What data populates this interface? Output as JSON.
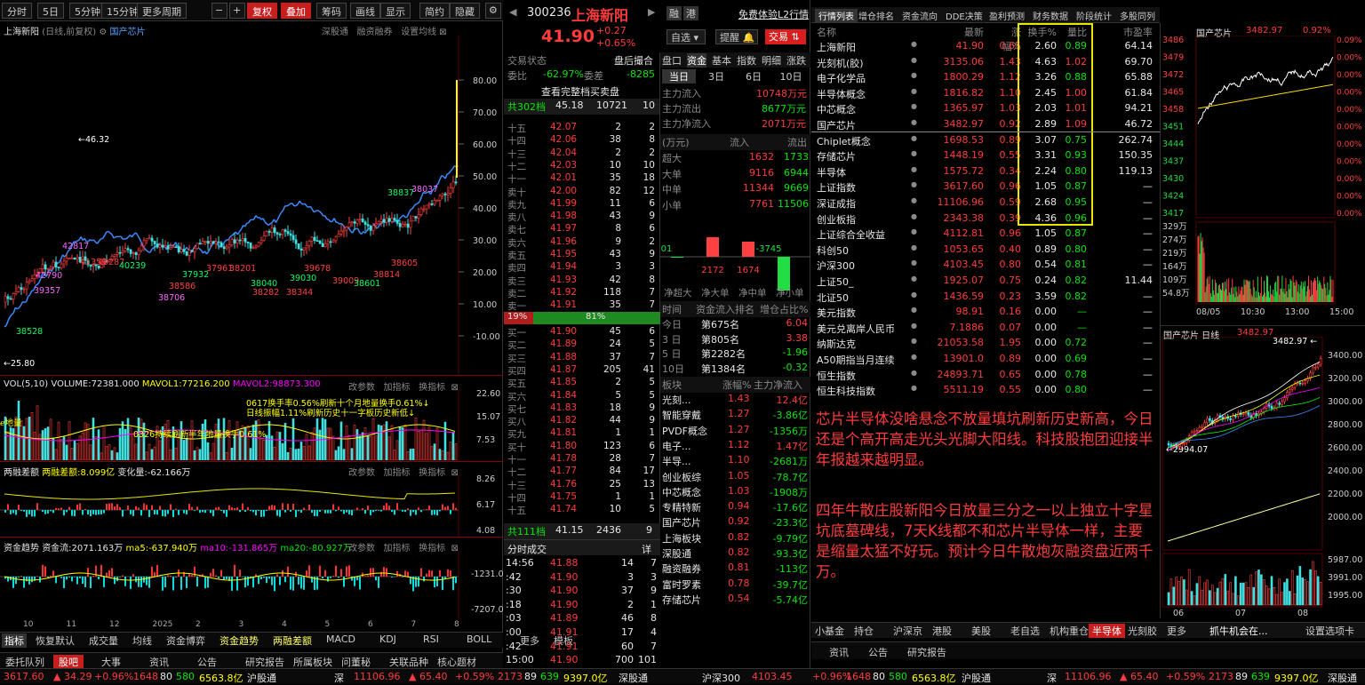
{
  "toolbar": {
    "items": [
      "分时",
      "5日",
      "5分钟",
      "15分钟",
      "更多周期",
      "复权",
      "叠加",
      "筹码",
      "画线",
      "显示",
      "简约",
      "隐藏"
    ],
    "stock_line": "上海新阳",
    "stock_opt": "(日线,前复权)",
    "concept": "国产芯片",
    "right_links": [
      "深股通",
      "融资融券",
      "设置均线"
    ]
  },
  "kchart": {
    "ylabels": [
      "80.00",
      "70.00",
      "60.00",
      "50.00",
      "40.00",
      "30.00",
      "20.00",
      "10.00",
      "-10.00"
    ],
    "hi_label": "46.32",
    "lo_label": "25.80",
    "markers": [
      "38528",
      "39357",
      "42790",
      "42817",
      "41359",
      "40287",
      "40239",
      "38586",
      "38706",
      "37932",
      "37961",
      "38201",
      "38040",
      "38282",
      "38344",
      "39030",
      "39678",
      "39009",
      "38601",
      "38814",
      "38605",
      "38837",
      "38037"
    ]
  },
  "vol": {
    "title": "VOL(5,10)",
    "v1": "VOLUME:72381.000",
    "v2": "MAVOL1:77216.200",
    "v3": "MAVOL2:98873.300",
    "note1": "0617换手率0.56%刷新十个月地量换手0.61%↓",
    "note2": "日线振幅1.11%刷新历史十一字板历史新低↓",
    "note3": "0326持续刷新半年地量换手0.61%",
    "note_left": "ℯ地量",
    "btns": [
      "改参数",
      "加指标",
      "换指标"
    ],
    "ylabels": [
      "22.60",
      "15.07",
      "7.53"
    ]
  },
  "rz": {
    "title": "两融差额",
    "v1": "两融差额:8.099亿",
    "v2": "变化量:-62.166万",
    "btns": [
      "改参数",
      "加指标",
      "换指标"
    ],
    "ylabels": [
      "8.26",
      "6.17",
      "4.08"
    ]
  },
  "fund": {
    "title": "资金趋势",
    "v1": "资金流:2071.163万",
    "v2": "ma5:-637.940万",
    "v3": "ma10:-131.865万",
    "v4": "ma20:-80.927万",
    "btns": [
      "改参数",
      "加指标",
      "换指标"
    ],
    "ylabels": [
      "-1231.00",
      "-7207.00"
    ]
  },
  "xaxis": [
    "10",
    "11",
    "12",
    "2025",
    "2",
    "3",
    "4",
    "5",
    "6",
    "7",
    "8"
  ],
  "indtabs": [
    "指标",
    "恢复默认",
    "成交量",
    "均线",
    "资金博弈",
    "资金趋势",
    "两融差额",
    "MACD",
    "KDJ",
    "RSI",
    "BOLL",
    "更多",
    "模板"
  ],
  "bottabs": [
    "委托队列",
    "股吧",
    "大事",
    "资讯",
    "公告",
    "研究报告",
    "所属板块",
    "问董秘",
    "关联品种",
    "核心题材"
  ],
  "status": {
    "sh": "3617.60",
    "sh_chg": "▲ 34.29",
    "sh_pct": "+0.96%",
    "sh_up": "1648",
    "sh_fl": "80",
    "sh_dn": "580",
    "sh_amt": "6563.8亿",
    "hgt": "沪股通",
    "sz": "深",
    "sz_val": "11106.96",
    "sz_chg": "▲ 65.40",
    "sz_pct": "+0.59%",
    "sz_up": "2173",
    "sz_fl": "89",
    "sz_dn": "639",
    "sz_amt": "9397.0亿",
    "sgt": "深股通",
    "hs300": "沪深300",
    "hs300_val": "4103.45"
  },
  "quote": {
    "code": "300236",
    "name": "上海新阳",
    "price": "41.90",
    "chg": "+0.27",
    "pct": "+0.65%",
    "btn1": "融",
    "btn2": "港",
    "promo": "免费体验L2行情",
    "btn_zx": "自选",
    "btn_tx": "提醒",
    "btn_jy": "交易",
    "state_label": "交易状态",
    "state_val": "盘后撮合",
    "wb_label": "委比",
    "wb_val": "-62.97%",
    "wc_label": "委差",
    "wc_val": "-8285",
    "full_link": "查看完整档买卖盘",
    "total_label": "共302档",
    "total_price": "45.18",
    "total_vol": "10721",
    "total_n": "10"
  },
  "asks": [
    [
      "十五",
      "42.07",
      "2",
      "2"
    ],
    [
      "十四",
      "42.06",
      "38",
      "8"
    ],
    [
      "十三",
      "42.04",
      "2",
      "2"
    ],
    [
      "十二",
      "42.03",
      "10",
      "10"
    ],
    [
      "十一",
      "42.01",
      "35",
      "18"
    ],
    [
      "卖十",
      "42.00",
      "82",
      "12"
    ],
    [
      "卖九",
      "41.99",
      "11",
      "6"
    ],
    [
      "卖八",
      "41.98",
      "43",
      "9"
    ],
    [
      "卖七",
      "41.97",
      "8",
      "6"
    ],
    [
      "卖六",
      "41.96",
      "9",
      "2"
    ],
    [
      "卖五",
      "41.95",
      "43",
      "9"
    ],
    [
      "卖四",
      "41.94",
      "3",
      "3"
    ],
    [
      "卖三",
      "41.93",
      "42",
      "8"
    ],
    [
      "卖二",
      "41.92",
      "118",
      "7"
    ],
    [
      "卖一",
      "41.91",
      "35",
      "7"
    ]
  ],
  "ratio": {
    "left": "19%",
    "right": "81%"
  },
  "bids": [
    [
      "买一",
      "41.90",
      "45",
      "6"
    ],
    [
      "买二",
      "41.89",
      "24",
      "5"
    ],
    [
      "买三",
      "41.88",
      "37",
      "7"
    ],
    [
      "买四",
      "41.87",
      "205",
      "41"
    ],
    [
      "买五",
      "41.85",
      "2",
      "5"
    ],
    [
      "买六",
      "41.84",
      "5",
      "5"
    ],
    [
      "买七",
      "41.83",
      "18",
      "9"
    ],
    [
      "买八",
      "41.82",
      "44",
      "9"
    ],
    [
      "买九",
      "41.81",
      "1",
      "1"
    ],
    [
      "买十",
      "41.80",
      "123",
      "6"
    ],
    [
      "十一",
      "41.78",
      "28",
      "7"
    ],
    [
      "十二",
      "41.77",
      "84",
      "17"
    ],
    [
      "十三",
      "41.76",
      "25",
      "13"
    ],
    [
      "十四",
      "41.75",
      "1",
      "1"
    ],
    [
      "十五",
      "41.74",
      "10",
      "5"
    ]
  ],
  "bid_total": {
    "label": "共111档",
    "price": "41.15",
    "vol": "2436",
    "n": "9"
  },
  "ticks": {
    "title": "分时成交",
    "detail": "详",
    "rows": [
      [
        "14:56",
        "41.88",
        "14",
        "7"
      ],
      [
        ":42",
        "41.90",
        "3",
        "3"
      ],
      [
        ":30",
        "41.90",
        "37",
        "9"
      ],
      [
        ":18",
        "41.90",
        "2",
        "1"
      ],
      [
        ":03",
        "41.89",
        "46",
        "8"
      ],
      [
        ":00",
        "41.91",
        "17",
        "4"
      ],
      [
        ":42",
        "41.91",
        "60",
        "7"
      ],
      [
        "15:00",
        "41.90",
        "700",
        "101"
      ]
    ]
  },
  "fundpanel": {
    "tabs1": [
      "盘口",
      "资金",
      "基本",
      "指数",
      "明细",
      "涨跌"
    ],
    "tabs2": [
      "当日",
      "3日",
      "6日",
      "10日"
    ],
    "inflow_l": "主力流入",
    "inflow_v": "10748万元",
    "outflow_l": "主力流出",
    "outflow_v": "8677万元",
    "net_l": "主力净流入",
    "net_v": "2071万元",
    "unit": "(万元)",
    "in_h": "流入",
    "out_h": "流出",
    "rows": [
      [
        "超大",
        "1632",
        "1733"
      ],
      [
        "大单",
        "9116",
        "6944"
      ],
      [
        "中单",
        "11344",
        "9669"
      ],
      [
        "小单",
        "7761",
        "11506"
      ]
    ],
    "bars": [
      "-101",
      "2172",
      "1674",
      "-3745"
    ],
    "bar_labels": [
      "净超大",
      "净大单",
      "净中单",
      "净小单"
    ],
    "rank_h": [
      "时间",
      "资金流入排名",
      "增仓占比%"
    ],
    "ranks": [
      [
        "今日",
        "第675名",
        "6.04"
      ],
      [
        "3 日",
        "第805名",
        "3.38"
      ],
      [
        "5 日",
        "第2282名",
        "-1.96"
      ],
      [
        "10日",
        "第1384名",
        "-0.32"
      ]
    ],
    "sec_h": [
      "板块",
      "涨幅%",
      "主力净流入"
    ],
    "sectors": [
      [
        "光刻...",
        "1.43",
        "12.4亿"
      ],
      [
        "智能穿戴",
        "1.27",
        "-3.86亿"
      ],
      [
        "PVDF概念",
        "1.27",
        "-1356万"
      ],
      [
        "电子...",
        "1.12",
        "1.47亿"
      ],
      [
        "半导...",
        "1.10",
        "-2681万"
      ],
      [
        "创业板综",
        "1.05",
        "-78.7亿"
      ],
      [
        "中芯概念",
        "1.03",
        "-1908万"
      ],
      [
        "专精特新",
        "0.94",
        "-17.6亿"
      ],
      [
        "国产芯片",
        "0.92",
        "-23.3亿"
      ],
      [
        "上海板块",
        "0.82",
        "-9.79亿"
      ],
      [
        "深股通",
        "0.82",
        "-93.3亿"
      ],
      [
        "融资融券",
        "0.81",
        "-113亿"
      ],
      [
        "富时罗素",
        "0.78",
        "-39.7亿"
      ],
      [
        "存储芯片",
        "0.54",
        "-5.74亿"
      ]
    ]
  },
  "rtabs": [
    "行情列表",
    "增仓排名",
    "资金流向",
    "DDE决策",
    "盈利预测",
    "财务数据",
    "阶段统计",
    "多股同列"
  ],
  "rheader": [
    "名称",
    "最新",
    "涨幅%",
    "换手%",
    "量比",
    "市盈率"
  ],
  "rrows": [
    [
      "上海新阳",
      "41.90",
      "0.65",
      "2.60",
      "0.89",
      "64.14"
    ],
    [
      "光刻机(胶)",
      "3135.06",
      "1.43",
      "4.63",
      "1.02",
      "69.70"
    ],
    [
      "电子化学品",
      "1800.29",
      "1.12",
      "3.26",
      "0.88",
      "65.88"
    ],
    [
      "半导体概念",
      "1816.82",
      "1.10",
      "2.45",
      "1.00",
      "61.84"
    ],
    [
      "中芯概念",
      "1365.97",
      "1.03",
      "2.03",
      "1.01",
      "94.21"
    ],
    [
      "国产芯片",
      "3482.97",
      "0.92",
      "2.89",
      "1.09",
      "46.72"
    ],
    [
      "Chiplet概念",
      "1698.53",
      "0.89",
      "3.07",
      "0.75",
      "262.74"
    ],
    [
      "存储芯片",
      "1448.19",
      "0.55",
      "3.31",
      "0.93",
      "150.35"
    ],
    [
      "半导体",
      "1575.72",
      "0.34",
      "2.24",
      "0.80",
      "119.13"
    ],
    [
      "上证指数",
      "3617.60",
      "0.96",
      "1.05",
      "0.87",
      "—"
    ],
    [
      "深证成指",
      "11106.96",
      "0.59",
      "2.68",
      "0.95",
      "—"
    ],
    [
      "创业板指",
      "2343.38",
      "0.39",
      "4.36",
      "0.96",
      "—"
    ],
    [
      "上证综合全收益",
      "4112.81",
      "0.96",
      "1.05",
      "0.87",
      "—"
    ],
    [
      "科创50",
      "1053.65",
      "0.40",
      "0.89",
      "0.80",
      "—"
    ],
    [
      "沪深300",
      "4103.45",
      "0.80",
      "0.54",
      "0.81",
      "—"
    ],
    [
      "上证50_",
      "1925.07",
      "0.75",
      "0.24",
      "0.82",
      "11.44"
    ],
    [
      "北证50",
      "1436.59",
      "0.23",
      "3.59",
      "0.82",
      "—"
    ],
    [
      "美元指数",
      "98.91",
      "0.16",
      "0.00",
      "—",
      "—"
    ],
    [
      "美元兑离岸人民币",
      "7.1886",
      "0.07",
      "0.00",
      "—",
      "—"
    ],
    [
      "纳斯达克",
      "21053.58",
      "1.95",
      "0.00",
      "0.72",
      "—"
    ],
    [
      "A50期指当月连续",
      "13901.0",
      "0.89",
      "0.00",
      "0.69",
      "—"
    ],
    [
      "恒生指数",
      "24893.71",
      "0.65",
      "0.00",
      "0.78",
      "—"
    ],
    [
      "恒生科技指数",
      "5511.19",
      "0.55",
      "0.00",
      "0.80",
      "—"
    ]
  ],
  "note": {
    "p1": "芯片半导体没啥悬念不放量填坑刷新历史新高，今日还是个高开高走光头光脚大阳线。科技股抱团迎接半年报越来越明显。",
    "p2": "四年牛散庄股新阳今日放量三分之一以上独立十字星坑底墓碑线，7天K线都不和芯片半导体一样，主要是缩量太猛不好玩。预计今日牛散炮灰融资盘近两千万。"
  },
  "mini": {
    "name": "国产芯片",
    "price": "3482.97",
    "pct": "0.92%",
    "ylabels": [
      "3486",
      "3479",
      "3472",
      "3465",
      "3458",
      "3451",
      "3444",
      "3437",
      "3430",
      "3424",
      "3417"
    ],
    "rlabels": [
      "0.09%",
      "0.00%",
      "0.00%",
      "0.00%",
      "0.00%",
      "0.00%",
      "0.00%",
      "0.00%",
      "0.00%",
      "0.00%",
      "0.00%"
    ],
    "vlabels": [
      "329万",
      "274万",
      "219万",
      "164万",
      "109万",
      "54.8万"
    ],
    "xlabels": [
      "08/05",
      "10:30",
      "13:00",
      "15:00"
    ],
    "k_title": "国产芯片 日线",
    "k_price": "3482.97",
    "k_vol": "9494万手",
    "k_hi": "3482.97",
    "k_lo": "2994.07",
    "k_ylabels": [
      "3400.00",
      "3200.00",
      "3000.00",
      "2800.00",
      "2600.00",
      "2400.00",
      "2200.00",
      "2000.00"
    ],
    "k_vlabels": [
      "5987.00",
      "3991.00",
      "1995.00"
    ],
    "k_xlabels": [
      "06",
      "07",
      "08"
    ]
  },
  "sectabs": [
    "小基金",
    "持仓",
    "沪深京",
    "港股",
    "美股",
    "老自选",
    "机构重仓",
    "半导体",
    "光刻胶",
    "更多"
  ],
  "sectabs_right": [
    "抓牛机会在...",
    "设置选项卡"
  ],
  "infotabs": [
    "资讯",
    "公告",
    "研究报告"
  ],
  "colors": {
    "up": "#ff3c3c",
    "down": "#00e600",
    "kbar_blue": "#3a8cff",
    "highlight": "#ffff00"
  }
}
